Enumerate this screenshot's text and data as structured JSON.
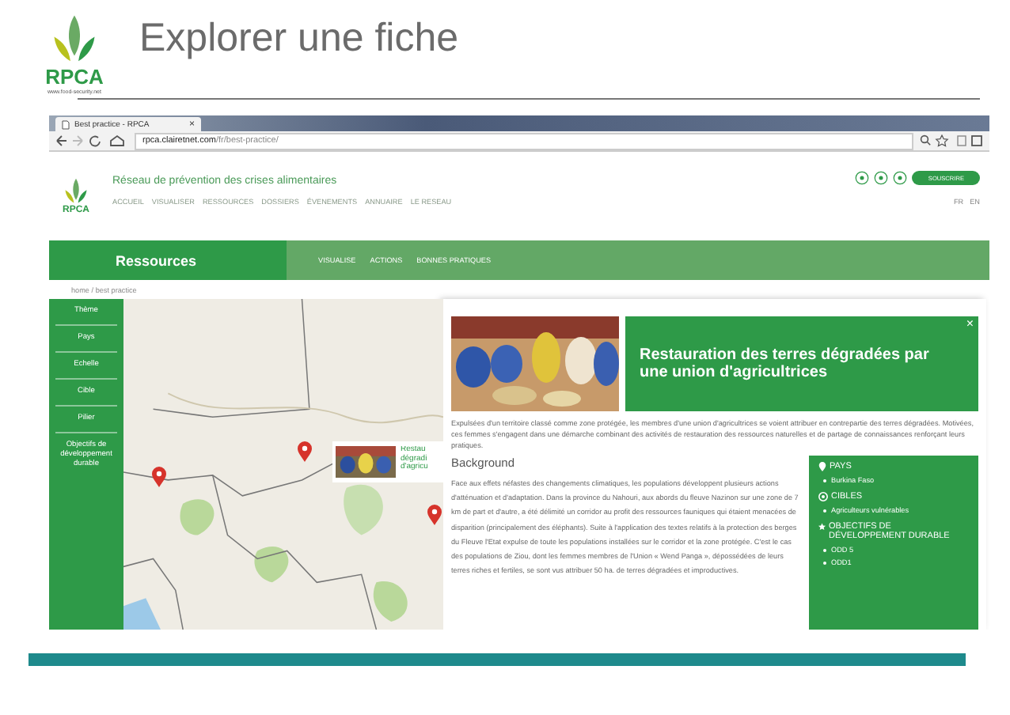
{
  "slide": {
    "logo_name": "RPCA",
    "logo_url": "www.food-security.net",
    "title": "Explorer une fiche"
  },
  "browser": {
    "tab_title": "Best practice - RPCA",
    "tab_close": "×",
    "url_host": "rpca.clairetnet.com",
    "url_path": "/fr/best-practice/"
  },
  "site": {
    "logo": "RPCA",
    "tagline": "Réseau de prévention des crises alimentaires",
    "nav": [
      "ACCUEIL",
      "VISUALISER",
      "RESSOURCES",
      "DOSSIERS",
      "ÉVENEMENTS",
      "ANNUAIRE",
      "LE RESEAU"
    ],
    "subscribe": "SOUSCRIRE",
    "languages": [
      "FR",
      "EN"
    ]
  },
  "section": {
    "title": "Ressources",
    "tabs": [
      "VISUALISE",
      "ACTIONS",
      "BONNES PRATIQUES"
    ]
  },
  "breadcrumb": "home / best practice",
  "filters": [
    "Thème",
    "Pays",
    "Echelle",
    "Cible",
    "Pilier",
    "Objectifs de développement durable"
  ],
  "map": {
    "popup_lines": [
      "Restau",
      "dégradi",
      "d'agricu"
    ]
  },
  "fiche": {
    "title": "Restauration des terres dégradées par une union d'agricultrices",
    "close": "×",
    "summary": "Expulsées d'un territoire classé comme zone protégée, les membres d'une union d'agricultrices se voient attribuer en contrepartie des terres dégradées. Motivées, ces femmes s'engagent dans une démarche combinant des activités de restauration des ressources naturelles et de partage de connaissances renforçant leurs pratiques.",
    "background_heading": "Background",
    "background": "Face aux effets néfastes des changements climatiques, les populations développent plusieurs actions d'atténuation et d'adaptation. Dans la province du Nahouri, aux abords du fleuve Nazinon sur une zone de 7 km de part et d'autre, a été délimité un corridor au profit des ressources fauniques qui étaient menacées de disparition (principalement des éléphants). Suite à l'application des textes relatifs à la protection des berges du Fleuve l'Etat expulse de toute les populations installées sur le corridor et la zone protégée. C'est le cas des populations de Ziou, dont les femmes membres de l'Union « Wend Panga », dépossédées de leurs terres riches et fertiles, se sont vus attribuer 50 ha. de terres dégradées et improductives.",
    "facts": [
      {
        "kind": "pin",
        "heading": "PAYS",
        "items": [
          "Burkina Faso"
        ]
      },
      {
        "kind": "target",
        "heading": "CIBLES",
        "items": [
          "Agriculteurs vulnérables"
        ]
      },
      {
        "kind": "star",
        "heading": "OBJECTIFS DE DÉVELOPPEMENT DURABLE",
        "items": [
          "ODD 5",
          "ODD1"
        ]
      }
    ]
  }
}
